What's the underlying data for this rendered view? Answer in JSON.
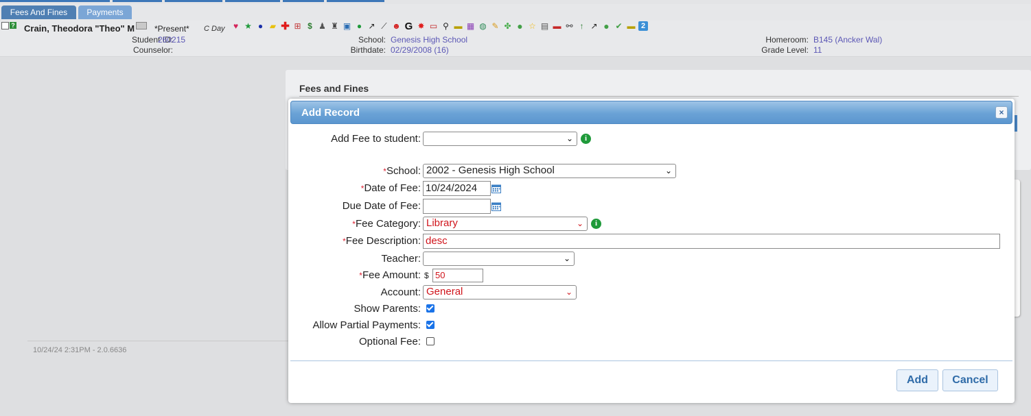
{
  "tabs": [
    {
      "label": "Fees And Fines",
      "active": true
    },
    {
      "label": "Payments",
      "active": false
    }
  ],
  "student": {
    "name": "Crain, Theodora \"Theo\" M",
    "attendance": "*Present*",
    "day": "C Day",
    "student_id_label": "Student ID:",
    "student_id": "260215",
    "counselor_label": "Counselor:",
    "counselor": "",
    "school_label": "School:",
    "school": "Genesis High School",
    "birthdate_label": "Birthdate:",
    "birthdate": "02/29/2008 (16)",
    "homeroom_label": "Homeroom:",
    "homeroom": "B145 (Ancker Wal)",
    "grade_label": "Grade Level:",
    "grade": "11",
    "flag_count": "2"
  },
  "background": {
    "panel_title": "Fees and Fines",
    "footer_timestamp": "10/24/24 2:31PM - 2.0.6636"
  },
  "modal": {
    "title": "Add Record",
    "close_label": "×",
    "fields": {
      "add_fee_to_student": {
        "label": "Add Fee to student:",
        "value": ""
      },
      "school": {
        "label": "School:",
        "value": "2002 - Genesis High School",
        "required": true
      },
      "date_of_fee": {
        "label": "Date of Fee:",
        "value": "10/24/2024",
        "required": true
      },
      "due_date_of_fee": {
        "label": "Due Date of Fee:",
        "value": ""
      },
      "fee_category": {
        "label": "Fee Category:",
        "value": "Library",
        "required": true
      },
      "fee_description": {
        "label": "Fee Description:",
        "value": "desc",
        "required": true
      },
      "teacher": {
        "label": "Teacher:",
        "value": ""
      },
      "fee_amount": {
        "label": "Fee Amount:",
        "currency": "$",
        "value": "50",
        "required": true
      },
      "account": {
        "label": "Account:",
        "value": "General"
      },
      "show_parents": {
        "label": "Show Parents:",
        "checked": true
      },
      "allow_partial_payments": {
        "label": "Allow Partial Payments:",
        "checked": true
      },
      "optional_fee": {
        "label": "Optional Fee:",
        "checked": false
      }
    },
    "required_marker": "*",
    "buttons": {
      "add": "Add",
      "cancel": "Cancel"
    }
  },
  "colors": {
    "accent": "#5b96cf",
    "required": "#d0141b",
    "link": "#5b57b5",
    "info_green": "#1f9a3a"
  }
}
